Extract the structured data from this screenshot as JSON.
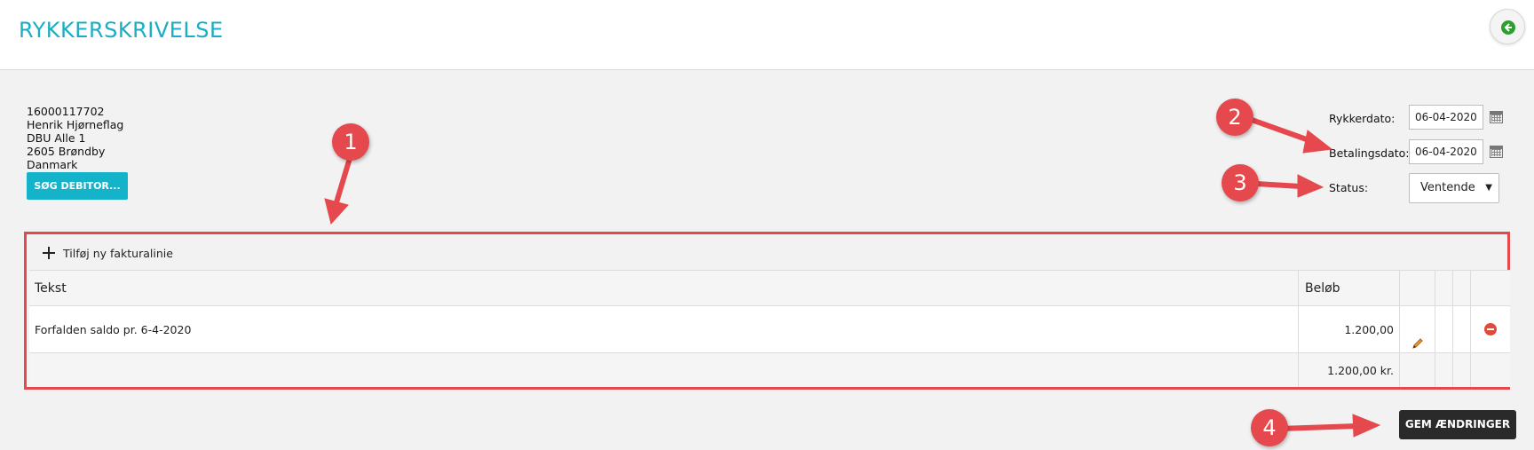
{
  "header": {
    "title": "RYKKERSKRIVELSE",
    "back_icon": "arrow-left-circle-icon",
    "back_color": "#2c9f2c"
  },
  "debtor": {
    "number": "16000117702",
    "name": "Henrik Hjørneflag",
    "address": "DBU Alle 1",
    "city": "2605 Brøndby",
    "country": "Danmark",
    "search_button": "SØG DEBITOR..."
  },
  "form": {
    "reminder_date_label": "Rykkerdato:",
    "reminder_date_value": "06-04-2020",
    "payment_date_label": "Betalingsdato:",
    "payment_date_value": "06-04-2020",
    "status_label": "Status:",
    "status_value": "Ventende"
  },
  "table": {
    "add_line": "Tilføj ny fakturalinie",
    "columns": {
      "text": "Tekst",
      "amount": "Beløb"
    },
    "rows": [
      {
        "text": "Forfalden saldo pr. 6-4-2020",
        "amount": "1.200,00"
      }
    ],
    "total": "1.200,00 kr."
  },
  "actions": {
    "save": "GEM ÆNDRINGER"
  },
  "annotations": [
    "1",
    "2",
    "3",
    "4"
  ],
  "colors": {
    "accent": "#1aaec4",
    "annotation": "#e5484d",
    "save_bg": "#2a2a2a"
  }
}
